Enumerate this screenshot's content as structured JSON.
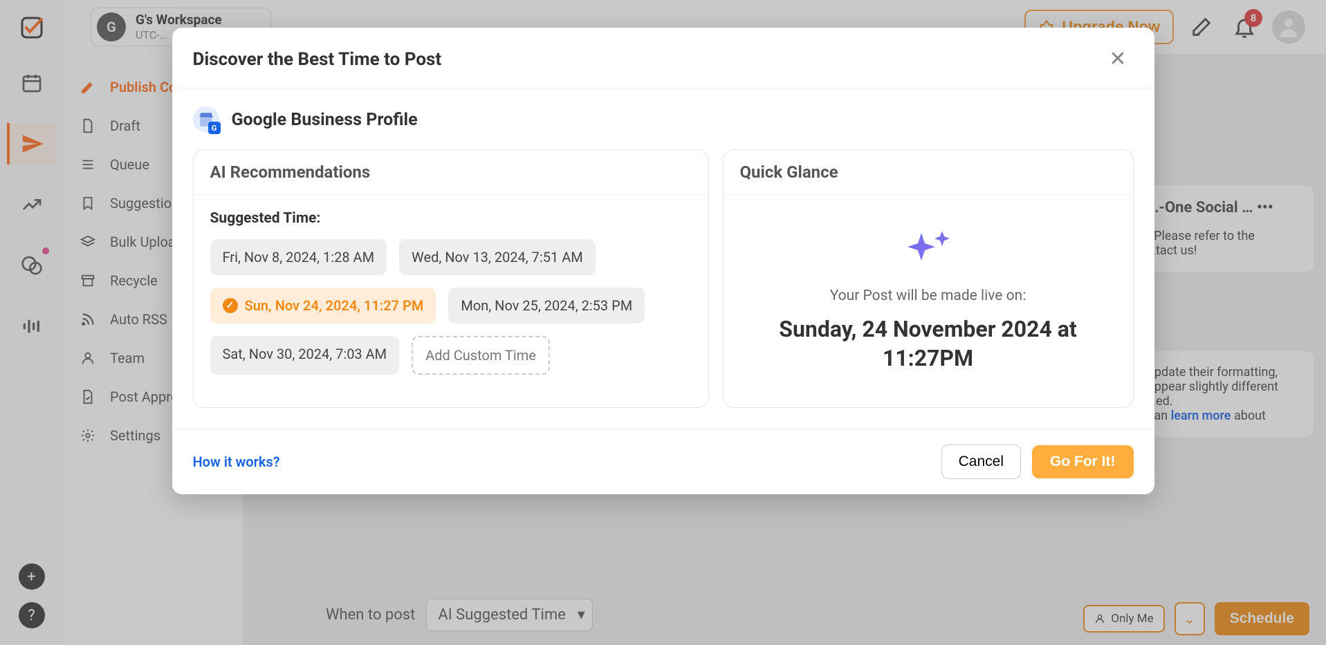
{
  "rail": {
    "add_tooltip": "+",
    "help_tooltip": "?"
  },
  "topbar": {
    "workspace_initial": "G",
    "workspace_name": "G's Workspace",
    "workspace_tz": "UTC-…",
    "upgrade_label": "Upgrade Now",
    "notification_count": "8"
  },
  "sidebar": {
    "items": [
      {
        "label": "Publish Content"
      },
      {
        "label": "Draft"
      },
      {
        "label": "Queue"
      },
      {
        "label": "Suggestions"
      },
      {
        "label": "Bulk Upload"
      },
      {
        "label": "Recycle"
      },
      {
        "label": "Auto RSS"
      },
      {
        "label": "Team"
      },
      {
        "label": "Post Approval"
      },
      {
        "label": "Settings"
      }
    ]
  },
  "main": {
    "card_title": "…-One Social …",
    "card_line1": "! Please refer to the",
    "card_line2": "…tact us!",
    "card_p1": "update their formatting,",
    "card_p2": "appear slightly different",
    "card_p3": "…ed.",
    "card_p4_a": " can ",
    "card_p4_link": "learn more",
    "card_p4_b": " about",
    "when_label": "When to post",
    "when_value": "AI Suggested Time",
    "only_me": "Only Me",
    "schedule": "Schedule"
  },
  "modal": {
    "title": "Discover the Best Time to Post",
    "profile": "Google Business Profile",
    "ai_header": "AI Recommendations",
    "suggested_label": "Suggested Time:",
    "times": [
      "Fri, Nov 8, 2024, 1:28 AM",
      "Wed, Nov 13, 2024, 7:51 AM",
      "Sun, Nov 24, 2024, 11:27 PM",
      "Mon, Nov 25, 2024, 2:53 PM",
      "Sat, Nov 30, 2024, 7:03 AM"
    ],
    "custom_label": "Add Custom Time",
    "quick_header": "Quick Glance",
    "qg_line1": "Your Post will be made live on:",
    "qg_line2": "Sunday, 24 November 2024 at 11:27PM",
    "how_link": "How it works?",
    "cancel": "Cancel",
    "go": "Go For It!"
  }
}
